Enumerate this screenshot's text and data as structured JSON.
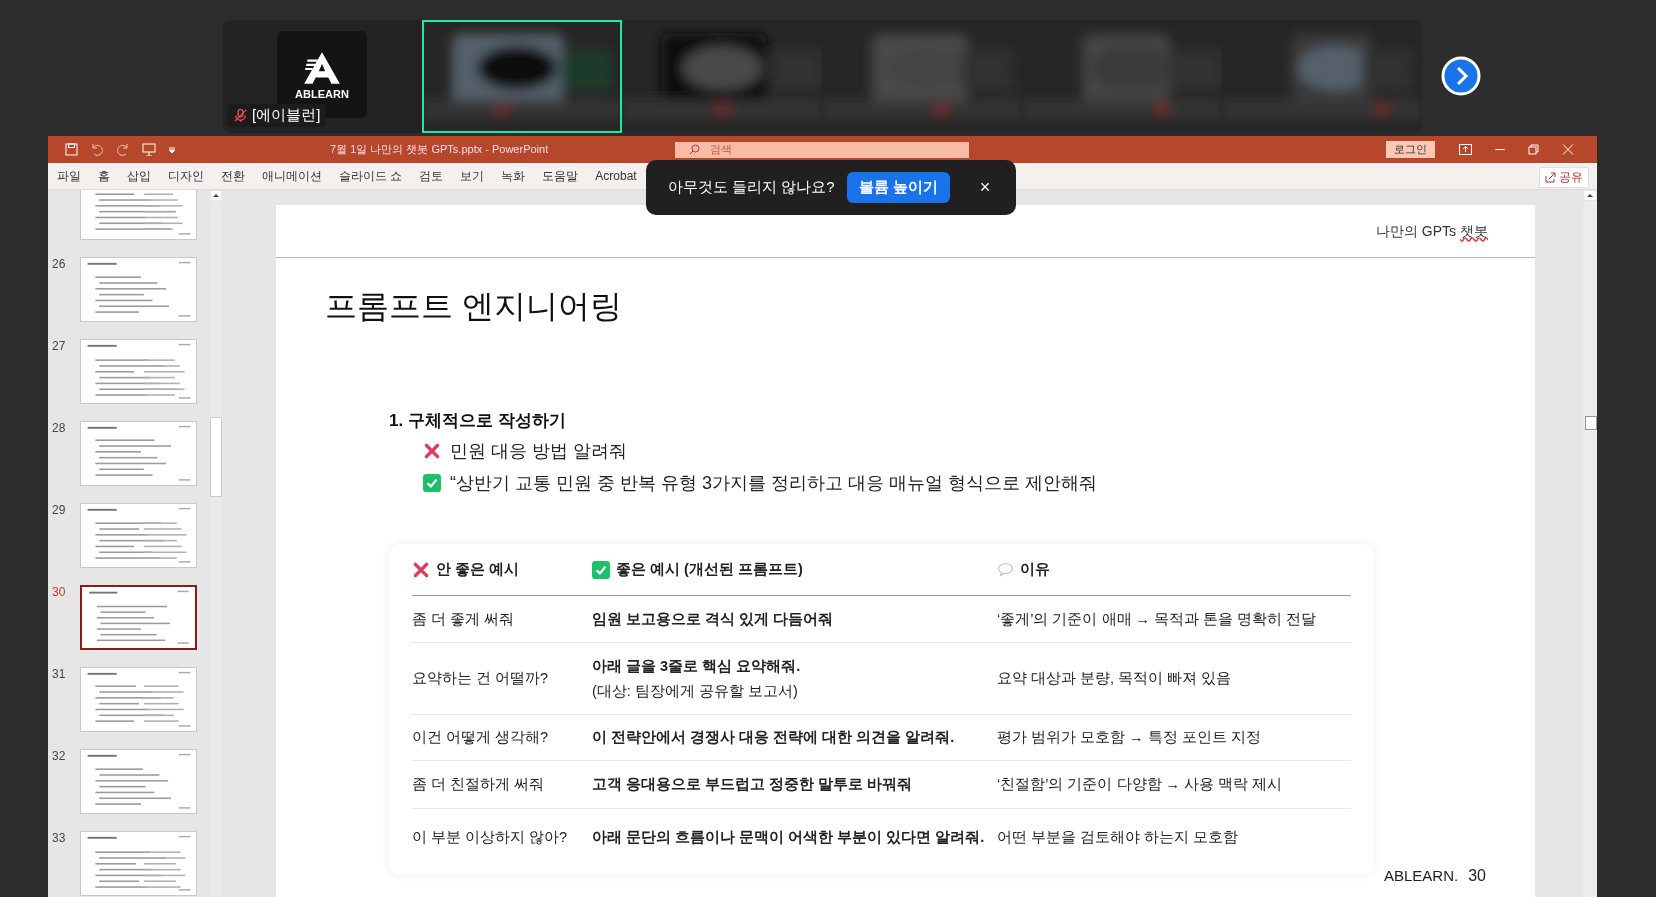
{
  "meeting_strip": {
    "tiles": [
      {
        "kind": "logo",
        "logo_text": "ABLEARN",
        "name": "[에이블런]",
        "muted": true,
        "selected": false
      },
      {
        "kind": "picture",
        "selected": true
      },
      {
        "kind": "picture",
        "selected": false
      },
      {
        "kind": "picture",
        "selected": false
      },
      {
        "kind": "picture",
        "selected": false
      },
      {
        "kind": "picture",
        "selected": false
      }
    ]
  },
  "powerpoint": {
    "title": "7월 1일 나만의 챗봇 GPTs.pptx  -  PowerPoint",
    "search": {
      "placeholder": "검색"
    },
    "login_button": "로그인",
    "ribbon_tabs": [
      "파일",
      "홈",
      "삽입",
      "디자인",
      "전환",
      "애니메이션",
      "슬라이드 쇼",
      "검토",
      "보기",
      "녹화",
      "도움말",
      "Acrobat"
    ],
    "share_button": "공유",
    "slide_panel": {
      "slides": [
        {
          "selected": false
        },
        {
          "number": "26",
          "selected": false
        },
        {
          "number": "27",
          "selected": false
        },
        {
          "number": "28",
          "selected": false
        },
        {
          "number": "29",
          "selected": false
        },
        {
          "number": "30",
          "selected": true
        },
        {
          "number": "31",
          "selected": false
        },
        {
          "number": "32",
          "selected": false
        },
        {
          "number": "33",
          "selected": false
        }
      ]
    },
    "slide": {
      "header": "나만의 GPTs",
      "header_flagged": "챗봇",
      "title": "프롬프트 엔지니어링",
      "section": "1. 구체적으로 작성하기",
      "points": [
        {
          "kind": "bad",
          "text": "민원 대응 방법 알려줘"
        },
        {
          "kind": "good",
          "text": "“상반기 교통 민원 중 반복 유형 3가지를 정리하고 대응 매뉴얼 형식으로 제안해줘"
        }
      ],
      "table": {
        "columns": [
          {
            "kind": "bad",
            "label": "안 좋은 예시"
          },
          {
            "kind": "good",
            "label": "좋은 예시 (개선된 프롬프트)"
          },
          {
            "kind": "reason",
            "label": "이유"
          }
        ],
        "rows": [
          {
            "bad": "좀 더 좋게 써줘",
            "good": "임원 보고용으로 격식 있게 다듬어줘",
            "reason": "‘좋게’의 기준이 애매 → 목적과 톤을 명확히 전달"
          },
          {
            "bad": "요약하는 건 어떨까?",
            "good": "아래 글을 3줄로 핵심 요약해줘.",
            "good_note": "(대상: 팀장에게 공유할 보고서)",
            "reason": "요약 대상과 분량, 목적이 빠져 있음"
          },
          {
            "bad": "이건 어떻게 생각해?",
            "good": "이 전략안에서 경쟁사 대응 전략에 대한 의견을 알려줘.",
            "reason": "평가 범위가 모호함 → 특정 포인트 지정"
          },
          {
            "bad": "좀 더 친절하게 써줘",
            "good": "고객 응대용으로 부드럽고 정중한 말투로 바꿔줘",
            "reason": "‘친절함’의 기준이 다양함 → 사용 맥락 제시"
          },
          {
            "bad": "이 부분 이상하지 않아?",
            "good": "아래 문단의 흐름이나 문맥이 어색한 부분이 있다면 알려줘.",
            "reason": "어떤 부분을 검토해야 하는지 모호함"
          }
        ]
      },
      "footer_brand": "ABLEARN.",
      "page_number": "30"
    },
    "toast": {
      "message": "아무것도 들리지 않나요?",
      "action": "볼륨 높이기",
      "close": "×"
    }
  }
}
